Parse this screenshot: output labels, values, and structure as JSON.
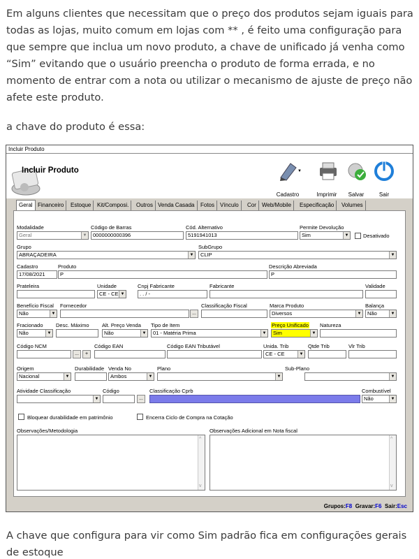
{
  "post": {
    "p1": "Em alguns clientes que necessitam que o preço dos produtos sejam iguais para todas as lojas, muito comum em lojas com ** , é feito uma configuração para que sempre que inclua um novo produto, a chave de unificado já venha como “Sim” evitando que o usuário preencha o produto de forma errada, e no momento de entrar com a nota ou utilizar o mecanismo de ajuste de preço não afete este produto.",
    "p2": "a chave do produto é essa:",
    "p3": "A chave que configura para vir como Sim padrão fica em configurações gerais de estoque"
  },
  "window": {
    "title": "Incluir Produto",
    "header_title": "Incluir Produto",
    "toolbar": {
      "cadastro": "Cadastro",
      "imprimir": "Imprimir",
      "salvar": "Salvar",
      "sair": "Sair"
    },
    "tabs": [
      "Geral",
      "Financeiro",
      "Estoque",
      "Kit/Composi.",
      "Outros",
      "Venda Casada",
      "Fotos",
      "Vínculo",
      "Cor",
      "Web/Mobile",
      "Especificação",
      "Volumes"
    ],
    "labels": {
      "modalidade": "Modalidade",
      "codigo_barras": "Código de Barras",
      "cod_alternativo": "Cód. Alternativo",
      "permite_devolucao": "Permite Devolução",
      "desativado": "Desativado",
      "grupo": "Grupo",
      "subgrupo": "SubGrupo",
      "cadastro": "Cadastro",
      "produto": "Produto",
      "descricao_abreviada": "Descrição Abreviada",
      "prateleira": "Prateleira",
      "unidade": "Unidade",
      "cnpj_fabricante": "Cnpj Fabricante",
      "fabricante": "Fabricante",
      "validade": "Validade",
      "beneficio_fiscal": "Benefício Fiscal",
      "fornecedor": "Fornecedor",
      "classificacao_fiscal": "Classificação Fiscal",
      "marca_produto": "Marca Produto",
      "balanca": "Balança",
      "fracionado": "Fracionado",
      "desc_maximo": "Desc. Máximo",
      "alt_preco_venda": "Alt. Preço Venda",
      "tipo_item": "Tipo de Item",
      "preco_unificado": "Preço Unificado",
      "natureza": "Natureza",
      "codigo_ncm": "Código NCM",
      "codigo_ean": "Código EAN",
      "codigo_ean_tributavel": "Código EAN Tributável",
      "unid_trib": "Unida. Trib",
      "qtde_trib": "Qtde Trib",
      "vlr_trib": "Vlr Trib",
      "origem": "Origem",
      "durabilidade": "Durabilidade",
      "venda_no": "Venda No",
      "plano": "Plano",
      "sub_plano": "Sub-Plano",
      "atividade_classificacao": "Atividade Classificação",
      "codigo": "Código",
      "classificacao_cprb": "Classificação Cprb",
      "combustivel": "Combustível",
      "bloquear": "Bloquear durabilidade em patrimônio",
      "encerra": "Encerra Ciclo de Compra na Cotação",
      "observacoes": "Observações/Metodologia",
      "observacoes_nf": "Observações Adicional em Nota fiscal"
    },
    "values": {
      "modalidade": "Geral",
      "codigo_barras": "0000000000396",
      "cod_alternativo": "5191941013",
      "permite_devolucao": "Sim",
      "grupo": "ABRAÇADEIRA",
      "subgrupo": "CLIP",
      "cadastro": "17/08/2021",
      "produto": "P",
      "descricao_abreviada": "P",
      "unidade": "CE - CE",
      "cnpj_fabricante": " .  .  /  -",
      "beneficio_fiscal": "Não",
      "marca_produto": "Diversos",
      "balanca": "Não",
      "fracionado": "Não",
      "alt_preco_venda": "Não",
      "tipo_item": "01 - Matéria Prima",
      "preco_unificado": "Sim",
      "unid_trib": "CE - CE",
      "origem": "Nacional",
      "venda_no": "Ambos",
      "combustivel": "Não",
      "ellipsis": "...",
      "plus": "+"
    },
    "status": {
      "grupos": "Grupos:",
      "grupos_key": "F8",
      "gravar": "Gravar:",
      "gravar_key": "F6",
      "sair": "Sair:",
      "sair_key": "Esc"
    },
    "colors": {
      "highlight": "#ffff00",
      "cprb": "#7b7bea",
      "sair_icon": "#1f7fd9"
    }
  }
}
